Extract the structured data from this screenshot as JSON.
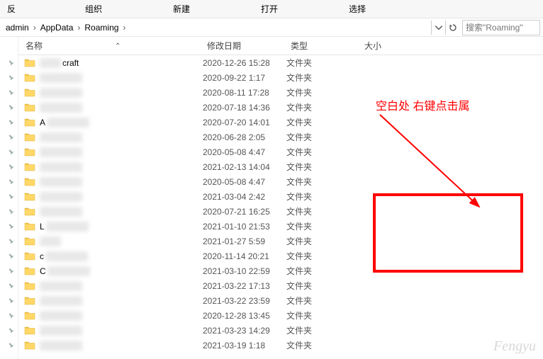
{
  "toolbar": {
    "items": [
      "反",
      "组织",
      "新建",
      "打开",
      "选择"
    ]
  },
  "breadcrumbs": [
    "admin",
    "AppData",
    "Roaming"
  ],
  "search": {
    "placeholder": "搜索\"Roaming\""
  },
  "columns": {
    "name": "名称",
    "date": "修改日期",
    "type": "类型",
    "size": "大小"
  },
  "type_label": "文件夹",
  "files": [
    {
      "name": "craft",
      "blurred": false,
      "prefix_blur": true,
      "date": "2020-12-26 15:28"
    },
    {
      "name": "",
      "blurred": true,
      "date": "2020-09-22 1:17"
    },
    {
      "name": "",
      "blurred": true,
      "date": "2020-08-11 17:28"
    },
    {
      "name": "",
      "blurred": true,
      "date": "2020-07-18 14:36"
    },
    {
      "name": "A",
      "blurred": true,
      "date": "2020-07-20 14:01"
    },
    {
      "name": "",
      "blurred": true,
      "date": "2020-06-28 2:05"
    },
    {
      "name": "",
      "blurred": true,
      "date": "2020-05-08 4:47"
    },
    {
      "name": "",
      "blurred": true,
      "date": "2021-02-13 14:04"
    },
    {
      "name": "",
      "blurred": true,
      "date": "2020-05-08 4:47"
    },
    {
      "name": "",
      "blurred": true,
      "date": "2021-03-04 2:42"
    },
    {
      "name": "",
      "blurred": true,
      "date": "2020-07-21 16:25"
    },
    {
      "name": "L",
      "blurred": true,
      "date": "2021-01-10 21:53"
    },
    {
      "name": "",
      "blurred": true,
      "small": true,
      "date": "2021-01-27 5:59"
    },
    {
      "name": "c",
      "blurred": true,
      "date": "2020-11-14 20:21"
    },
    {
      "name": "C",
      "blurred": true,
      "date": "2021-03-10 22:59"
    },
    {
      "name": "",
      "blurred": true,
      "date": "2021-03-22 17:13"
    },
    {
      "name": "",
      "blurred": true,
      "date": "2021-03-22 23:59"
    },
    {
      "name": "",
      "blurred": true,
      "date": "2020-12-28 13:45"
    },
    {
      "name": "",
      "blurred": true,
      "date": "2021-03-23 14:29"
    },
    {
      "name": "",
      "blurred": true,
      "date": "2021-03-19 1:18"
    }
  ],
  "annotation": {
    "text": "空白处 右键点击属"
  },
  "watermark": "Fengyu"
}
